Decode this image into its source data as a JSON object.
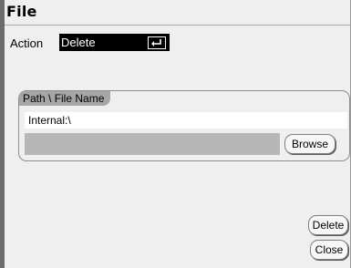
{
  "window": {
    "title": "File"
  },
  "action": {
    "label": "Action",
    "selected_value": "Delete",
    "enter_icon": "enter-return-icon"
  },
  "path_group": {
    "title": "Path \\ File Name",
    "path_value": "Internal:\\",
    "file_value": "",
    "browse_label": "Browse"
  },
  "buttons": {
    "delete_label": "Delete",
    "close_label": "Close"
  },
  "colors": {
    "background": "#efefef",
    "selected_field": "#000000",
    "group_tab": "#a6a6a6",
    "file_field": "#b7b7b7"
  }
}
